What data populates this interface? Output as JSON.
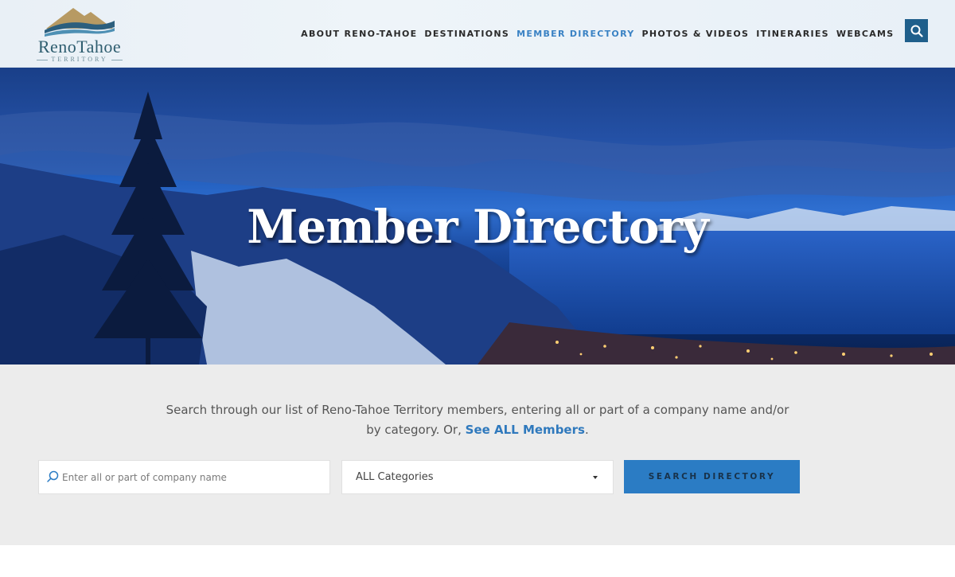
{
  "logo": {
    "name": "RenoTahoe",
    "tagline": "TERRITORY"
  },
  "nav": {
    "items": [
      {
        "label": "ABOUT RENO-TAHOE",
        "active": false
      },
      {
        "label": "DESTINATIONS",
        "active": false
      },
      {
        "label": "MEMBER DIRECTORY",
        "active": true
      },
      {
        "label": "PHOTOS & VIDEOS",
        "active": false
      },
      {
        "label": "ITINERARIES",
        "active": false
      },
      {
        "label": "WEBCAMS",
        "active": false
      }
    ],
    "search_icon": "search-icon"
  },
  "hero": {
    "title": "Member Directory"
  },
  "intro": {
    "text_before": "Search through our list of Reno-Tahoe Territory members, entering all or part of a company name and/or by category. Or, ",
    "link_text": "See ALL Members",
    "text_after": "."
  },
  "search": {
    "placeholder": "Enter all or part of company name",
    "category_selected": "ALL Categories",
    "submit_label": "SEARCH DIRECTORY"
  },
  "colors": {
    "accent": "#2b7cc4",
    "active_nav": "#3a82c4",
    "search_button_bg": "#1f5f8b"
  }
}
